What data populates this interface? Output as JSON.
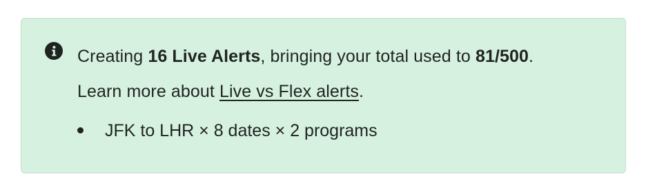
{
  "alert": {
    "icon": "info-icon",
    "colors": {
      "background": "#d6f1e0",
      "text": "#1f2420"
    },
    "line1": {
      "prefix": "Creating ",
      "count_bold": "16 Live Alerts",
      "middle": ", bringing your total used to ",
      "total_bold": "81/500",
      "suffix": "."
    },
    "line2": {
      "prefix": "Learn more about ",
      "link_text": "Live vs Flex alerts",
      "suffix": "."
    },
    "items": [
      "JFK to LHR × 8 dates × 2 programs"
    ]
  }
}
